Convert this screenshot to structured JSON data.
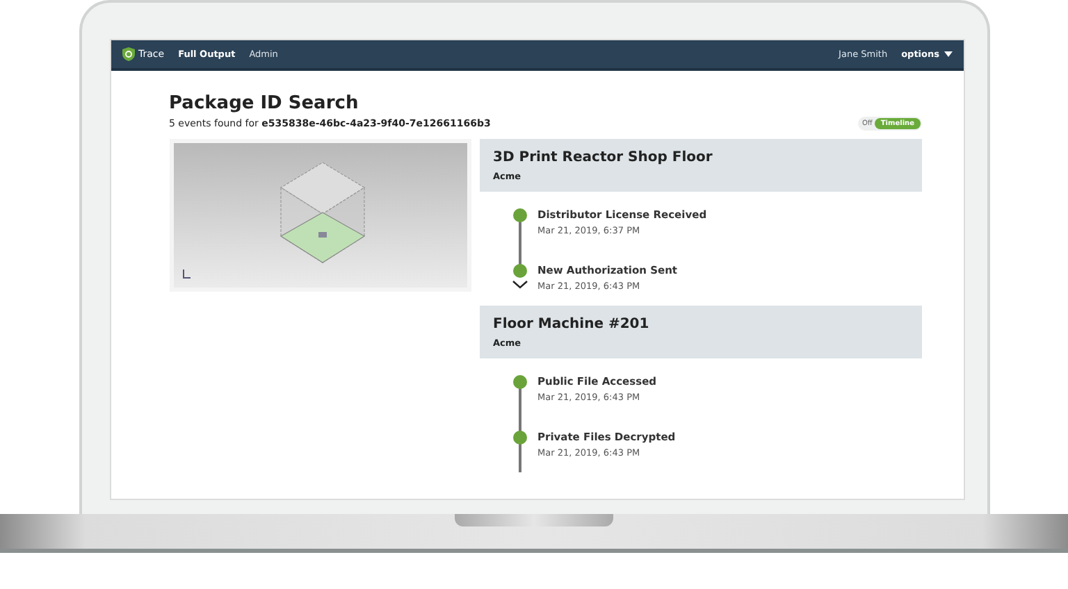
{
  "navbar": {
    "brand": "Trace",
    "links": [
      {
        "label": "Full Output",
        "selected": true
      },
      {
        "label": "Admin",
        "selected": false
      }
    ],
    "user": "Jane Smith",
    "menu": "options"
  },
  "page": {
    "title": "Package ID Search",
    "summary": "5 events found for **e535838e-46bc-4a23-9f40-7e12661166b3**",
    "view_toggle": {
      "off_label": "Off",
      "on_label": "Timeline",
      "on": true
    }
  },
  "groups": [
    {
      "title": "3D Print Reactor Shop Floor",
      "owner": "Acme",
      "expanded": false,
      "events": [
        {
          "title": "Distributor License Received",
          "time": "Mar 21, 2019, 6:37 PM"
        },
        {
          "title": "New Authorization Sent",
          "time": "Mar 21, 2019, 6:43 PM"
        }
      ]
    },
    {
      "title": "Floor Machine #201",
      "owner": "Acme",
      "expanded": true,
      "events": [
        {
          "title": "Public File Accessed",
          "time": "Mar 21, 2019, 6:43 PM"
        },
        {
          "title": "Private Files Decrypted",
          "time": "Mar 21, 2019, 6:43 PM"
        }
      ]
    }
  ]
}
